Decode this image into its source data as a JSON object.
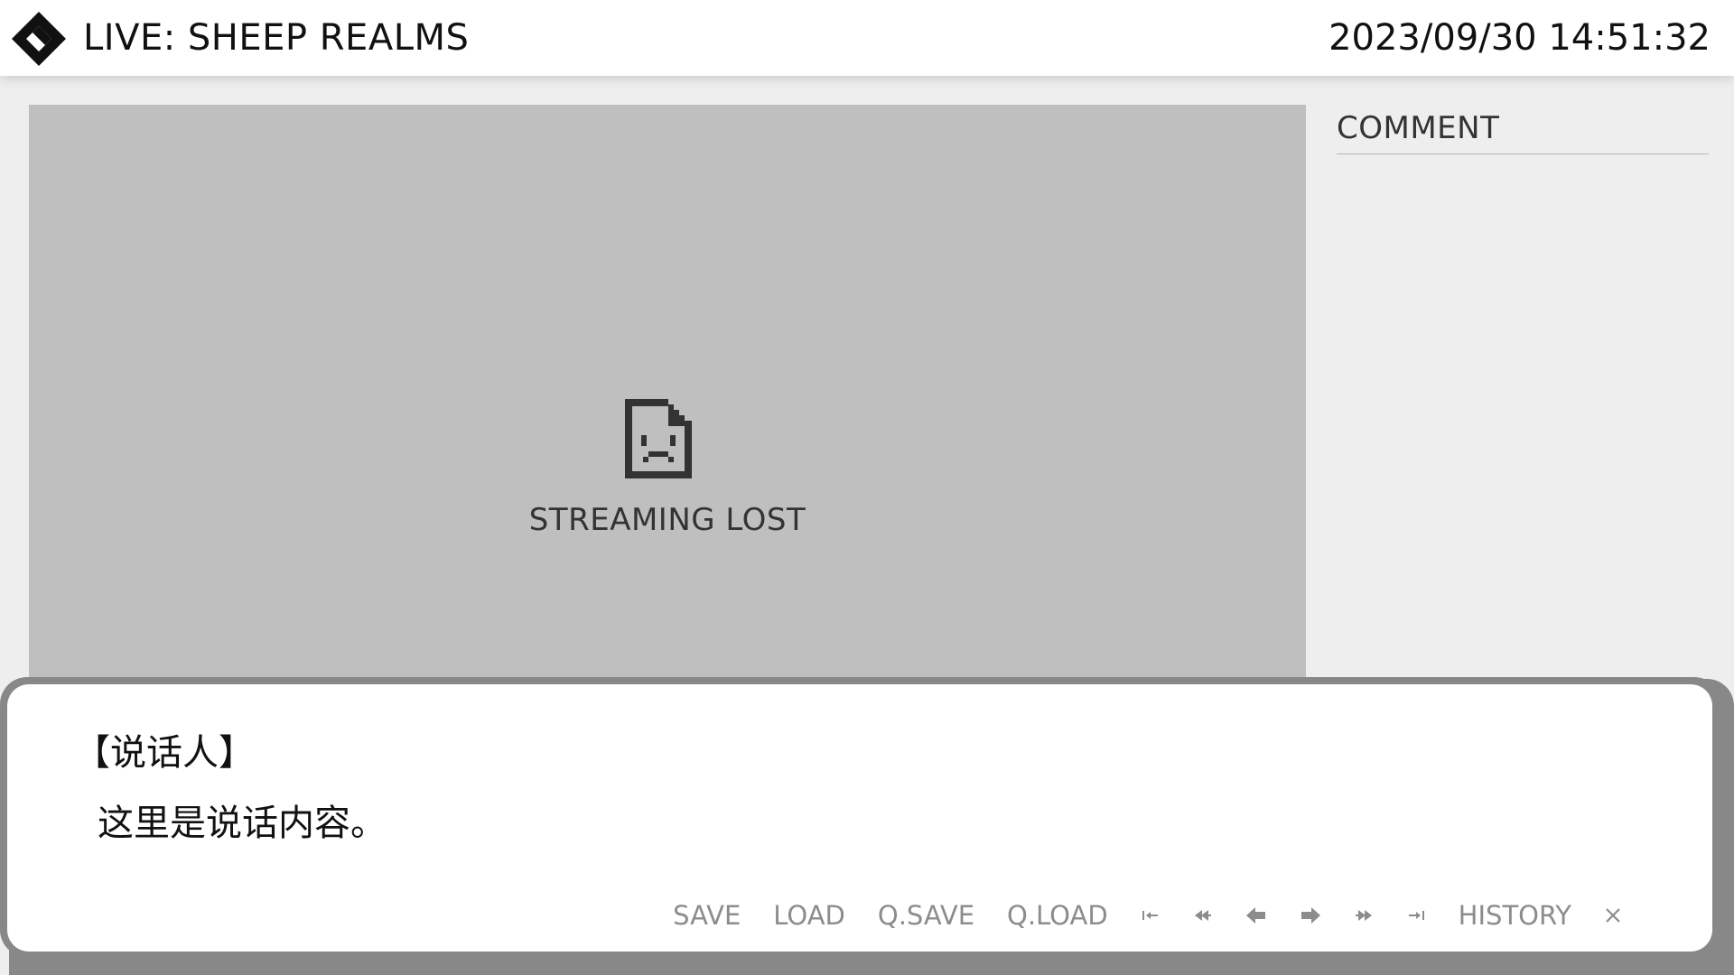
{
  "header": {
    "title": "LIVE: SHEEP REALMS",
    "datetime": "2023/09/30 14:51:32",
    "logo_icon": "diamond-logo-icon"
  },
  "stream": {
    "status_text": "STREAMING LOST",
    "status_icon": "sad-document-icon"
  },
  "comments": {
    "label": "COMMENT"
  },
  "dialog": {
    "speaker": "【说话人】",
    "text": "这里是说话内容。"
  },
  "controls": {
    "save": "SAVE",
    "load": "LOAD",
    "qsave": "Q.SAVE",
    "qload": "Q.LOAD",
    "history": "HISTORY",
    "icons": [
      "skip-to-start-icon",
      "rewind-icon",
      "back-icon",
      "forward-icon",
      "fast-forward-icon",
      "skip-to-end-icon",
      "close-icon"
    ]
  },
  "colors": {
    "header_bg": "#ffffff",
    "page_bg": "#eeeeee",
    "stream_bg": "#bfbfbf",
    "dialog_border": "#888888",
    "control_text": "#8c8c8c"
  }
}
